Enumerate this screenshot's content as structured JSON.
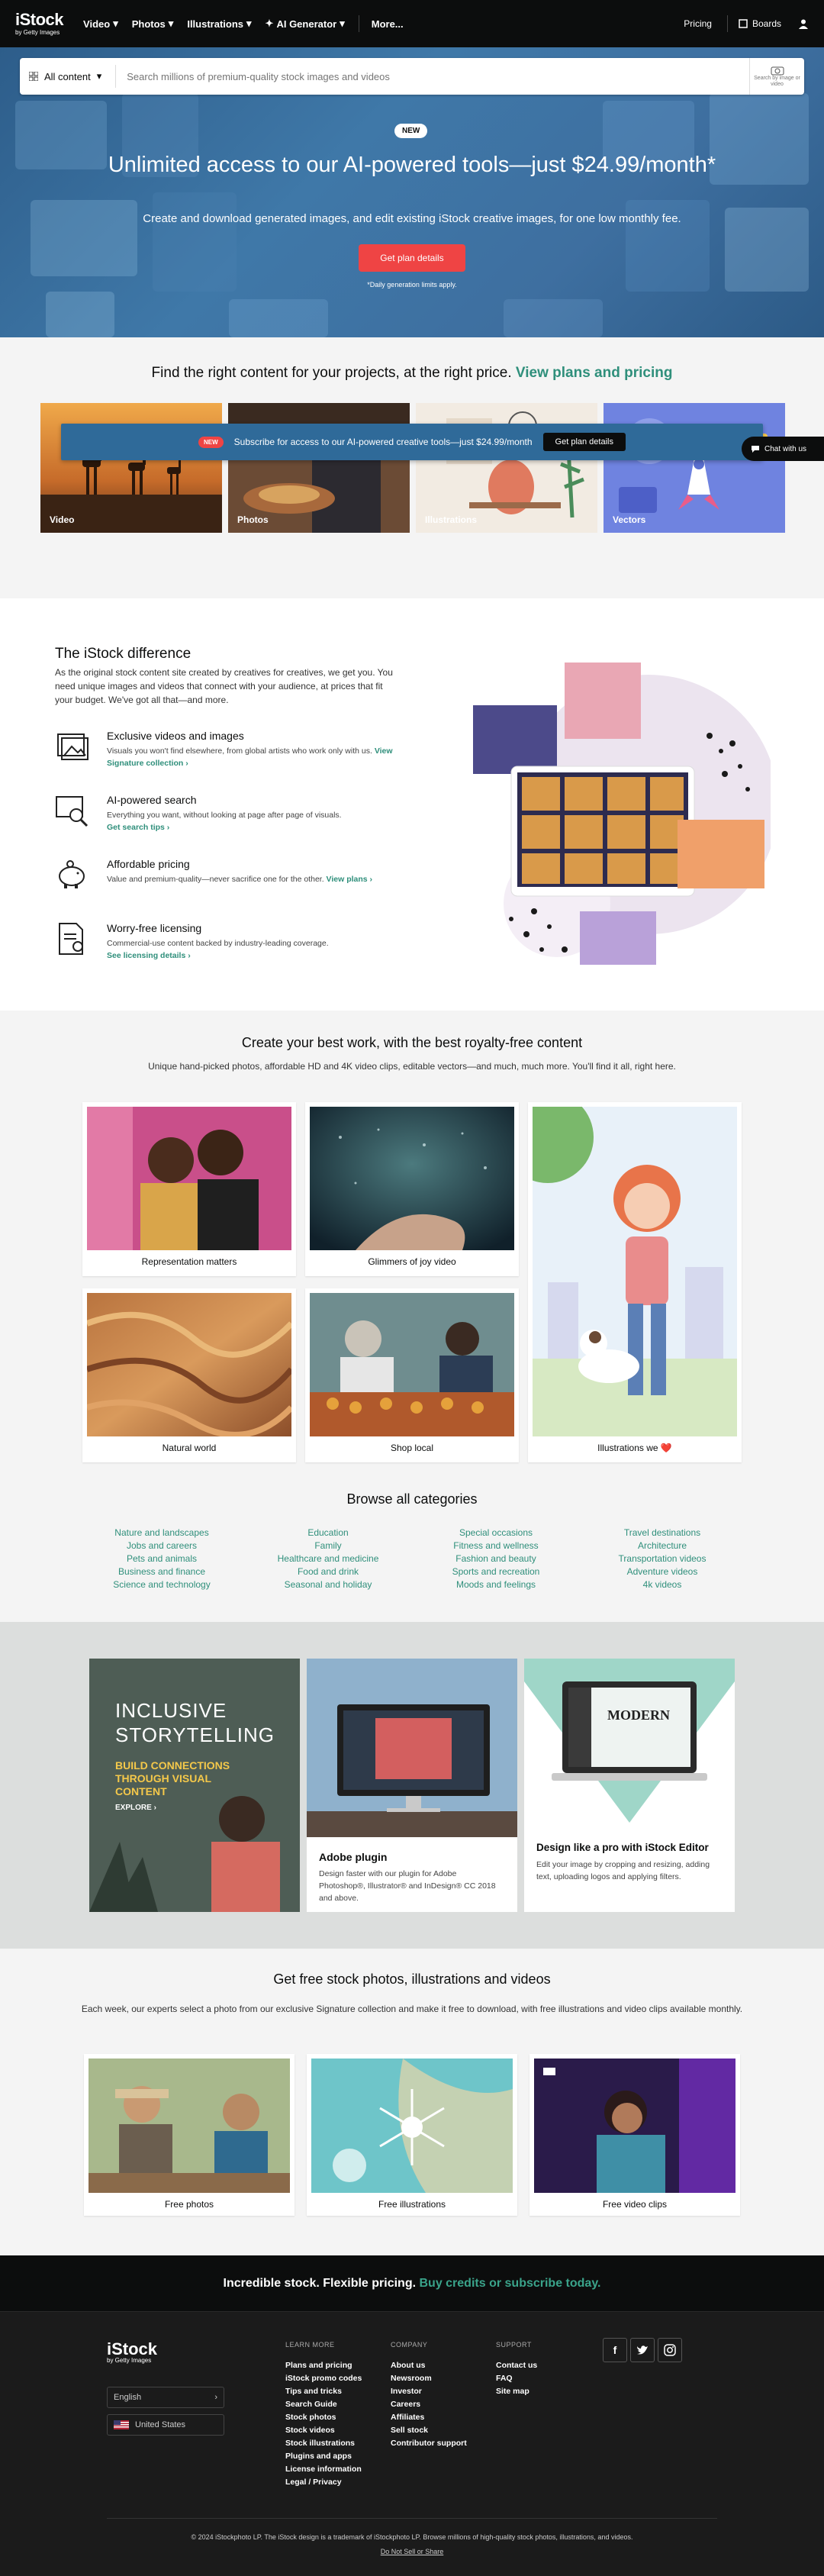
{
  "nav": {
    "logo": "iStock",
    "logo_sub": "by Getty Images",
    "items": [
      "Video",
      "Photos",
      "Illustrations",
      "AI Generator",
      "More..."
    ],
    "pricing": "Pricing",
    "boards": "Boards"
  },
  "search": {
    "scope": "All content",
    "placeholder": "Search millions of premium-quality stock images and videos",
    "visual": "Search by image or video"
  },
  "hero": {
    "badge": "NEW",
    "title": "Unlimited access to our AI-powered tools—just $24.99/month*",
    "subtitle": "Create and download generated images, and edit existing iStock creative images, for one low monthly fee.",
    "cta": "Get plan details",
    "fine": "*Daily generation limits apply."
  },
  "find": {
    "title": "Find the right content for your projects, at the right price.",
    "link": "View plans and pricing",
    "tiles": [
      "Video",
      "Photos",
      "Illustrations",
      "Vectors"
    ]
  },
  "banner": {
    "badge": "NEW",
    "text": "Subscribe for access to our AI-powered creative tools—just $24.99/month",
    "button": "Get plan details"
  },
  "chat": "Chat with us",
  "difference": {
    "title": "The iStock difference",
    "intro": "As the original stock content site created by creatives for creatives, we get you. You need unique images and videos that connect with your audience, at prices that fit your budget. We've got all that—and more.",
    "features": [
      {
        "title": "Exclusive videos and images",
        "desc": "Visuals you won't find elsewhere, from global artists who work only with us.",
        "link": "View Signature collection ›"
      },
      {
        "title": "AI-powered search",
        "desc": "Everything you want, without looking at page after page of visuals.",
        "link": "Get search tips ›"
      },
      {
        "title": "Affordable pricing",
        "desc": "Value and premium-quality—never sacrifice one for the other.",
        "link": "View plans ›"
      },
      {
        "title": "Worry-free licensing",
        "desc": "Commercial-use content backed by industry-leading coverage.",
        "link": "See licensing details ›"
      }
    ]
  },
  "best": {
    "title": "Create your best work, with the best royalty-free content",
    "subtitle": "Unique hand-picked photos, affordable HD and 4K video clips, editable vectors—and much, much more. You'll find it all, right here.",
    "cards": [
      "Representation matters",
      "Glimmers of joy video",
      "Illustrations we ❤️",
      "Natural world",
      "Shop local"
    ]
  },
  "categories": {
    "title": "Browse all categories",
    "columns": [
      [
        "Nature and landscapes",
        "Jobs and careers",
        "Pets and animals",
        "Business and finance",
        "Science and technology"
      ],
      [
        "Education",
        "Family",
        "Healthcare and medicine",
        "Food and drink",
        "Seasonal and holiday"
      ],
      [
        "Special occasions",
        "Fitness and wellness",
        "Fashion and beauty",
        "Sports and recreation",
        "Moods and feelings"
      ],
      [
        "Travel destinations",
        "Architecture",
        "Transportation videos",
        "Adventure videos",
        "4k videos"
      ]
    ]
  },
  "promos": {
    "inclusive": {
      "line1": "INCLUSIVE",
      "line2": "STORYTELLING",
      "sub": "BUILD CONNECTIONS THROUGH VISUAL CONTENT",
      "explore": "EXPLORE ›"
    },
    "adobe": {
      "title": "Adobe plugin",
      "desc": "Design faster with our plugin for Adobe Photoshop®, Illustrator® and InDesign® CC 2018 and above."
    },
    "editor": {
      "title": "Design like a pro with iStock Editor",
      "desc": "Edit your image by cropping and resizing, adding text, uploading logos and applying filters.",
      "screen_word": "MODERN"
    }
  },
  "free": {
    "title": "Get free stock photos, illustrations and videos",
    "subtitle": "Each week, our experts select a photo from our exclusive Signature collection and make it free to download, with free illustrations and video clips available monthly.",
    "cards": [
      "Free photos",
      "Free illustrations",
      "Free video clips"
    ]
  },
  "footer": {
    "tagline": "Incredible stock. Flexible pricing.",
    "tagline_link": "Buy credits or subscribe today.",
    "language": "English",
    "country": "United States",
    "learn_more": {
      "heading": "LEARN MORE",
      "items": [
        "Plans and pricing",
        "iStock promo codes",
        "Tips and tricks",
        "Search Guide",
        "Stock photos",
        "Stock videos",
        "Stock illustrations",
        "Plugins and apps",
        "License information",
        "Legal / Privacy"
      ]
    },
    "company": {
      "heading": "COMPANY",
      "items": [
        "About us",
        "Newsroom",
        "Investor",
        "Careers",
        "Affiliates",
        "Sell stock",
        "Contributor support"
      ]
    },
    "support": {
      "heading": "SUPPORT",
      "items": [
        "Contact us",
        "FAQ",
        "Site map"
      ]
    },
    "social": [
      "f",
      "t",
      "ig"
    ],
    "copyright": "© 2024 iStockphoto LP. The iStock design is a trademark of iStockphoto LP. Browse millions of high-quality stock photos, illustrations, and videos.",
    "dns": "Do Not Sell or Share"
  },
  "colors": {
    "teal": "#2f8f7b",
    "cta_red": "#ef4444",
    "nav_bg": "#0c0d0d"
  }
}
